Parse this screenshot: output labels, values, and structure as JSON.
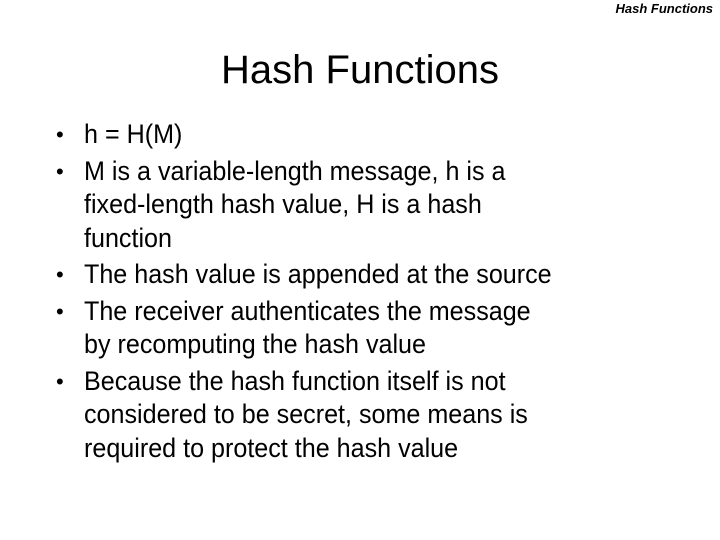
{
  "header": {
    "running_title": "Hash Functions"
  },
  "slide": {
    "title": "Hash Functions",
    "bullets": [
      {
        "lines": [
          "h = H(M)"
        ]
      },
      {
        "lines": [
          "M is a variable-length message, h is a",
          "fixed-length hash value, H is a hash",
          "function"
        ]
      },
      {
        "lines": [
          "The hash value is appended at the source"
        ]
      },
      {
        "lines": [
          "The receiver authenticates the message",
          "by recomputing the hash value"
        ]
      },
      {
        "lines": [
          "Because the hash function itself is not",
          "considered to be secret, some means is",
          "required to protect the hash value"
        ]
      }
    ]
  },
  "icons": {
    "bullet": "•"
  }
}
